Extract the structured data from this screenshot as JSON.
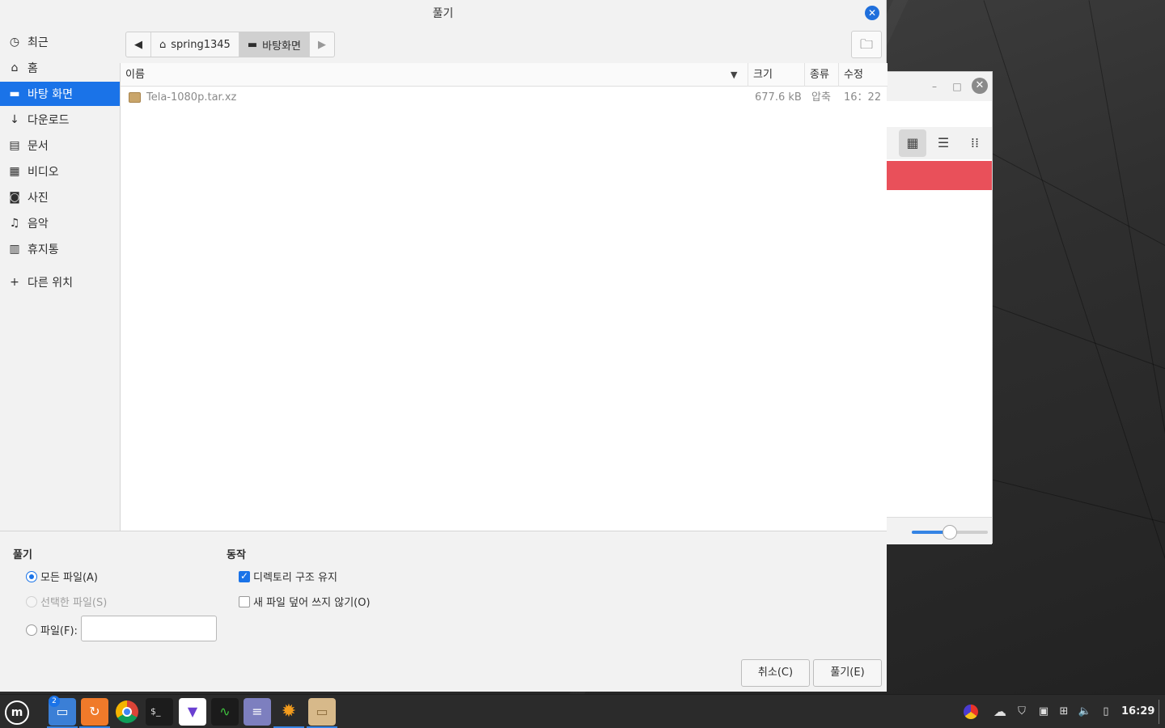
{
  "dialog": {
    "title": "풀기",
    "close_icon": "close-icon",
    "accent_color": "#1a73e8"
  },
  "sidebar": {
    "items": [
      {
        "label": "최근",
        "icon": "clock-icon"
      },
      {
        "label": "홈",
        "icon": "home-icon"
      },
      {
        "label": "바탕 화면",
        "icon": "desktop-icon",
        "selected": true
      },
      {
        "label": "다운로드",
        "icon": "download-icon"
      },
      {
        "label": "문서",
        "icon": "document-icon"
      },
      {
        "label": "비디오",
        "icon": "video-icon"
      },
      {
        "label": "사진",
        "icon": "camera-icon"
      },
      {
        "label": "음악",
        "icon": "music-icon"
      },
      {
        "label": "휴지통",
        "icon": "trash-icon"
      },
      {
        "label": "다른 위치",
        "icon": "plus-icon"
      }
    ]
  },
  "pathbar": {
    "home_label": "spring1345",
    "current_label": "바탕화면"
  },
  "columns": {
    "name": "이름",
    "size": "크기",
    "type": "종류",
    "modified": "수정"
  },
  "files": [
    {
      "name": "Tela-1080p.tar.xz",
      "size": "677.6 kB",
      "type": "압축",
      "modified": "16：22"
    }
  ],
  "options": {
    "extract_heading": "풀기",
    "all_files": "모든 파일(A)",
    "selected_files": "선택한 파일(S)",
    "files_label": "파일(F):",
    "files_value": "",
    "actions_heading": "동작",
    "keep_structure": "디렉토리 구조 유지",
    "keep_structure_checked": true,
    "no_overwrite": "새 파일 덮어 쓰지 않기(O)",
    "no_overwrite_checked": false
  },
  "buttons": {
    "cancel": "취소(C)",
    "extract": "풀기(E)"
  },
  "taskbar": {
    "badge_count": "2",
    "clock": "16:29"
  },
  "background_window": {
    "zoom_level": 0.5
  }
}
